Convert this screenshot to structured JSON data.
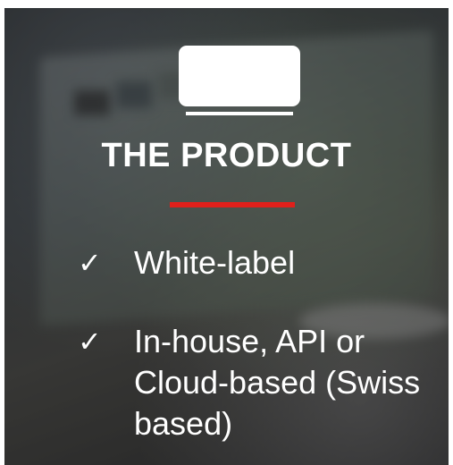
{
  "title": "THE PRODUCT",
  "accent_color": "#e0201b",
  "icon": "monitor-icon",
  "features": [
    {
      "check": "✓",
      "label": "White-label"
    },
    {
      "check": "✓",
      "label": "In-house, API or Cloud-based (Swiss based)"
    }
  ]
}
